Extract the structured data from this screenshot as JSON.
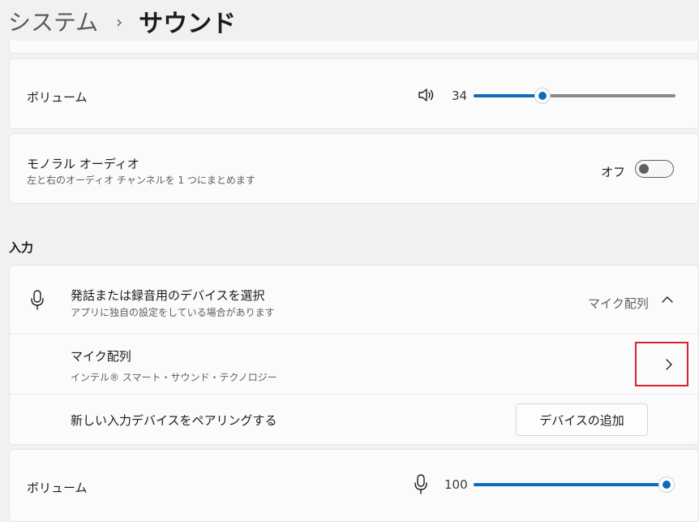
{
  "breadcrumb": {
    "parent": "システム",
    "separator": "›",
    "current": "サウンド"
  },
  "output_volume": {
    "label": "ボリューム",
    "value": "34",
    "level_percent": 34,
    "icon": "speaker-icon"
  },
  "mono_audio": {
    "title": "モノラル オーディオ",
    "subtitle": "左と右のオーディオ チャンネルを 1 つにまとめます",
    "state_label": "オフ",
    "enabled": false
  },
  "input_section": {
    "header": "入力",
    "device_select": {
      "title": "発話または録音用のデバイスを選択",
      "subtitle": "アプリに独自の設定をしている場合があります",
      "selected_device": "マイク配列",
      "icon": "microphone-icon"
    },
    "device_item": {
      "name": "マイク配列",
      "description": "インテル® スマート・サウンド・テクノロジー"
    },
    "pair_new": {
      "label": "新しい入力デバイスをペアリングする",
      "button": "デバイスの追加"
    }
  },
  "input_volume": {
    "label": "ボリューム",
    "value": "100",
    "level_percent": 100,
    "icon": "microphone-icon"
  },
  "colors": {
    "accent": "#0f6cbd",
    "highlight_box": "#d8232a"
  }
}
